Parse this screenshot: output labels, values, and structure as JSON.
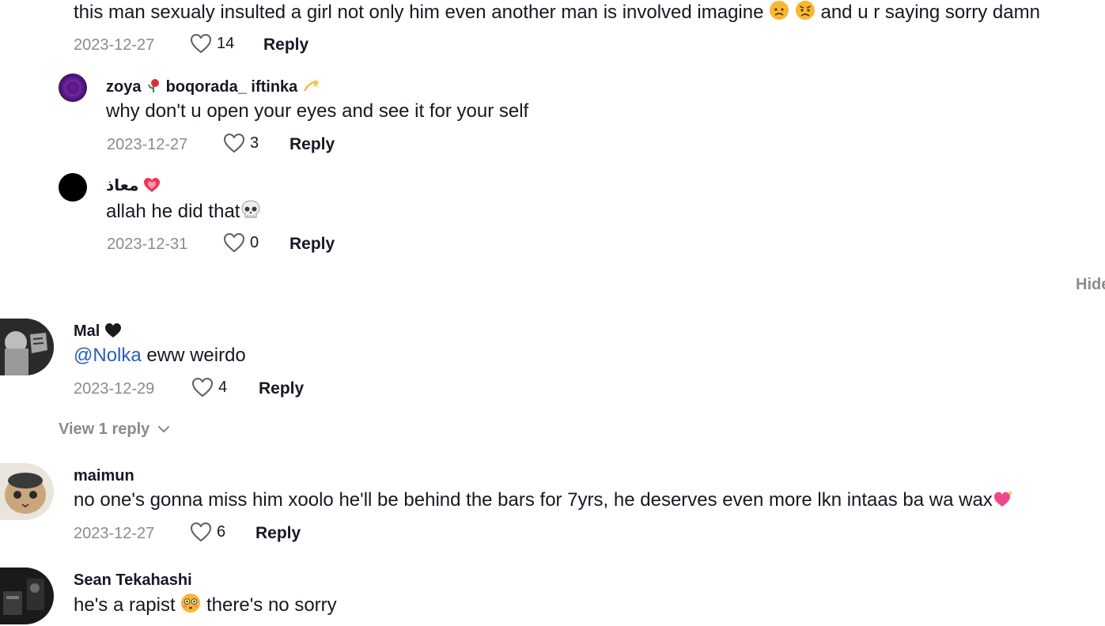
{
  "comments": {
    "top": {
      "text_pre": "this man sexualy insulted a girl not only him even another man is involved imagine",
      "text_post": "and u r saying sorry damn",
      "date": "2023-12-27",
      "likes": "14",
      "reply_label": "Reply"
    },
    "reply1": {
      "name_a": "zoya",
      "name_b": "boqorada_ iftinka",
      "text": "why don't u open your eyes and see it for your self",
      "date": "2023-12-27",
      "likes": "3",
      "reply_label": "Reply"
    },
    "reply2": {
      "name": "معاذ",
      "text": "allah he did that",
      "date": "2023-12-31",
      "likes": "0",
      "reply_label": "Reply"
    },
    "hide_label": "Hide",
    "mal": {
      "name": "Mal",
      "mention": "@Nolka",
      "text": " eww weirdo",
      "date": "2023-12-29",
      "likes": "4",
      "reply_label": "Reply",
      "view_replies": "View 1 reply"
    },
    "maimun": {
      "name": "maimun",
      "text": "no one's gonna miss him xoolo he'll be behind the bars for 7yrs, he deserves even more lkn intaas ba wa wax",
      "date": "2023-12-27",
      "likes": "6",
      "reply_label": "Reply"
    },
    "sean": {
      "name": "Sean Tekahashi",
      "text_pre": "he's a rapist",
      "text_post": "there's no sorry"
    }
  },
  "colors": {
    "text": "#161823",
    "muted": "#8a8b91",
    "mention": "#2b5db9"
  },
  "icons": [
    "heart-outline-icon",
    "chevron-down-icon",
    "skull-emoji",
    "heart-emoji",
    "sparkling-heart-emoji",
    "flushed-emoji",
    "angry-emoji",
    "rose-emoji",
    "dizzy-emoji",
    "black-heart-emoji"
  ]
}
